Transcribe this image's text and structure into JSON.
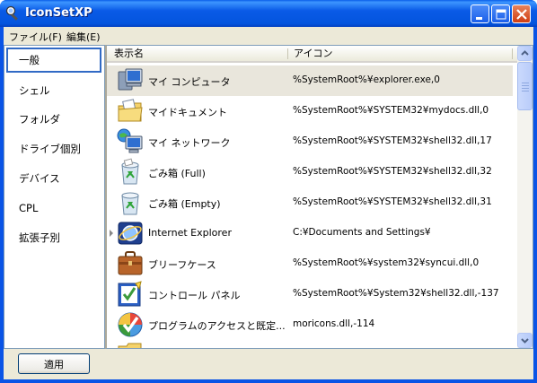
{
  "window": {
    "title": "IconSetXP",
    "app_icon": "magnifier-wrench-icon",
    "controls": [
      "minimize-icon",
      "maximize-icon",
      "close-icon"
    ]
  },
  "menu": [
    {
      "label": "ファイル(F)"
    },
    {
      "label": "編集(E)"
    }
  ],
  "sidebar": {
    "items": [
      {
        "label": "一般",
        "selected": true
      },
      {
        "label": "シェル"
      },
      {
        "label": "フォルダ"
      },
      {
        "label": "ドライブ個別"
      },
      {
        "label": "デバイス"
      },
      {
        "label": "CPL"
      },
      {
        "label": "拡張子別"
      }
    ]
  },
  "list": {
    "columns": [
      "表示名",
      "アイコン"
    ],
    "rows": [
      {
        "name": "マイ コンピュータ",
        "path": "%SystemRoot%¥explorer.exe,0",
        "icon": "my-computer-icon",
        "selected": true
      },
      {
        "name": "マイドキュメント",
        "path": "%SystemRoot%¥SYSTEM32¥mydocs.dll,0",
        "icon": "my-documents-icon"
      },
      {
        "name": "マイ ネットワーク",
        "path": "%SystemRoot%¥SYSTEM32¥shell32.dll,17",
        "icon": "my-network-icon"
      },
      {
        "name": "ごみ箱 (Full)",
        "path": "%SystemRoot%¥SYSTEM32¥shell32.dll,32",
        "icon": "recycle-bin-full-icon"
      },
      {
        "name": "ごみ箱 (Empty)",
        "path": "%SystemRoot%¥SYSTEM32¥shell32.dll,31",
        "icon": "recycle-bin-empty-icon"
      },
      {
        "name": "Internet Explorer",
        "path": "C:¥Documents and Settings¥",
        "icon": "internet-explorer-icon"
      },
      {
        "name": "ブリーフケース",
        "path": "%SystemRoot%¥system32¥syncui.dll,0",
        "icon": "briefcase-icon"
      },
      {
        "name": "コントロール パネル",
        "path": "%SystemRoot%¥System32¥shell32.dll,-137",
        "icon": "control-panel-icon"
      },
      {
        "name": "プログラムのアクセスと既定...",
        "path": "moricons.dll,-114",
        "icon": "program-access-icon"
      },
      {
        "name": "",
        "path": "",
        "icon": "folder-icon"
      }
    ]
  },
  "footer": {
    "apply_label": "適用"
  }
}
